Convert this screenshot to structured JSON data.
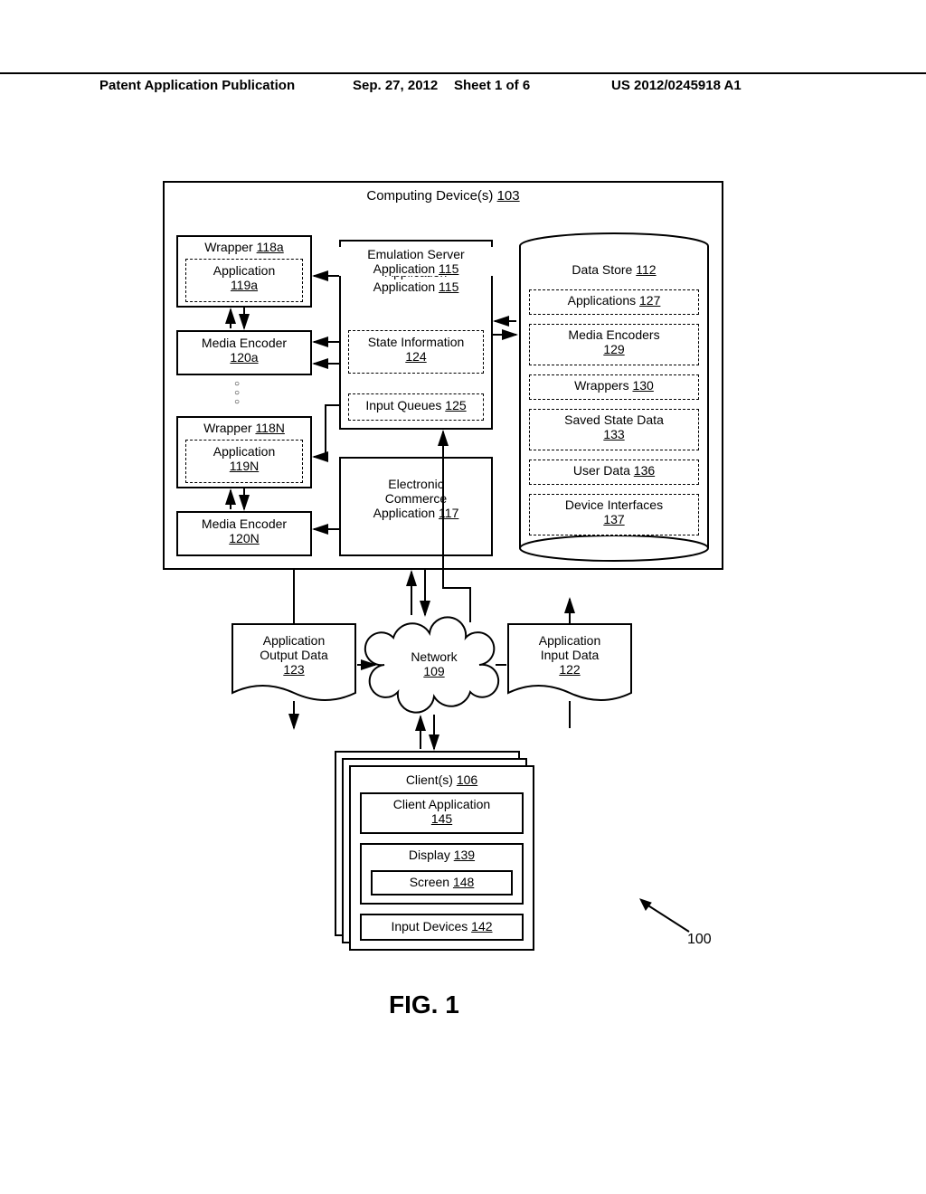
{
  "header": {
    "pub": "Patent Application Publication",
    "date": "Sep. 27, 2012",
    "sheet": "Sheet 1 of 6",
    "num": "US 2012/0245918 A1"
  },
  "computing": {
    "title": "Computing Device(s)",
    "ref": "103"
  },
  "wrapper_a": {
    "title": "Wrapper",
    "ref": "118a"
  },
  "app_a": {
    "title": "Application",
    "ref": "119a"
  },
  "enc_a": {
    "title": "Media Encoder",
    "ref": "120a"
  },
  "wrapper_n": {
    "title": "Wrapper",
    "ref": "118N"
  },
  "app_n": {
    "title": "Application",
    "ref": "119N"
  },
  "enc_n": {
    "title": "Media Encoder",
    "ref": "120N"
  },
  "emu": {
    "title": "Emulation Server Application",
    "ref": "115"
  },
  "state": {
    "title": "State Information",
    "ref": "124"
  },
  "queues": {
    "title": "Input Queues",
    "ref": "125"
  },
  "ecom": {
    "title": "Electronic Commerce Application",
    "ref": "117"
  },
  "store": {
    "title": "Data Store",
    "ref": "112"
  },
  "apps": {
    "title": "Applications",
    "ref": "127"
  },
  "encs": {
    "title": "Media Encoders",
    "ref": "129"
  },
  "wraps": {
    "title": "Wrappers",
    "ref": "130"
  },
  "saved": {
    "title": "Saved State Data",
    "ref": "133"
  },
  "user": {
    "title": "User Data",
    "ref": "136"
  },
  "dev": {
    "title": "Device Interfaces",
    "ref": "137"
  },
  "out": {
    "title": "Application Output Data",
    "ref": "123"
  },
  "in": {
    "title": "Application Input Data",
    "ref": "122"
  },
  "net": {
    "title": "Network",
    "ref": "109"
  },
  "client": {
    "title": "Client(s)",
    "ref": "106"
  },
  "capp": {
    "title": "Client Application",
    "ref": "145"
  },
  "disp": {
    "title": "Display",
    "ref": "139"
  },
  "scr": {
    "title": "Screen",
    "ref": "148"
  },
  "idev": {
    "title": "Input Devices",
    "ref": "142"
  },
  "sys": "100",
  "figure": "FIG. 1"
}
